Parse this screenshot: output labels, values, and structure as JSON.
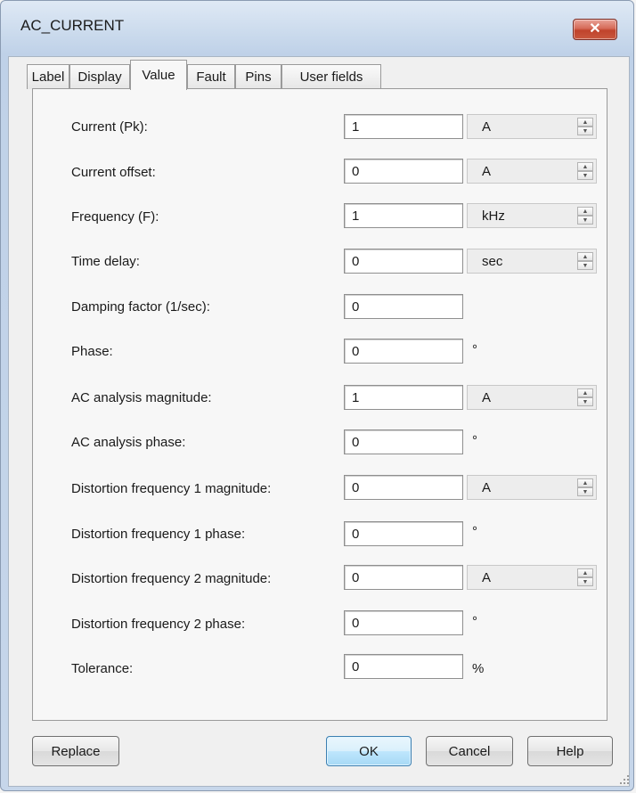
{
  "window": {
    "title": "AC_CURRENT",
    "close_icon": "close-icon"
  },
  "tabs": [
    "Label",
    "Display",
    "Value",
    "Fault",
    "Pins",
    "User fields"
  ],
  "active_tab": "Value",
  "rows": [
    {
      "label": "Current (Pk):",
      "value": "1",
      "unit": "A"
    },
    {
      "label": "Current offset:",
      "value": "0",
      "unit": "A"
    },
    {
      "label": "Frequency (F):",
      "value": "1",
      "unit": "kHz"
    },
    {
      "label": "Time delay:",
      "value": "0",
      "unit": "sec"
    },
    {
      "label": "Damping factor (1/sec):",
      "value": "0"
    },
    {
      "label": "Phase:",
      "value": "0",
      "suffix": "°"
    },
    {
      "label": "AC analysis magnitude:",
      "value": "1",
      "unit": "A"
    },
    {
      "label": "AC analysis phase:",
      "value": "0",
      "suffix": "°"
    },
    {
      "label": "Distortion frequency 1 magnitude:",
      "value": "0",
      "unit": "A"
    },
    {
      "label": "Distortion frequency 1 phase:",
      "value": "0",
      "suffix": "°"
    },
    {
      "label": "Distortion frequency 2 magnitude:",
      "value": "0",
      "unit": "A"
    },
    {
      "label": "Distortion frequency 2 phase:",
      "value": "0",
      "suffix": "°"
    },
    {
      "label": "Tolerance:",
      "value": "0",
      "suffix": "%"
    }
  ],
  "buttons": {
    "replace": "Replace",
    "ok": "OK",
    "cancel": "Cancel",
    "help": "Help"
  }
}
